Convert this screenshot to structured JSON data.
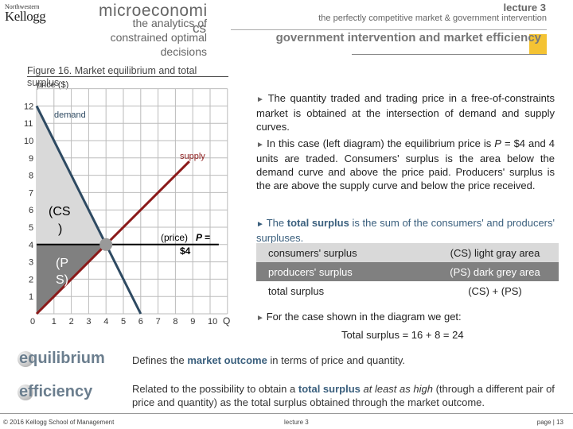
{
  "header": {
    "logo_top": "Northwestern",
    "logo_main": "Kellogg",
    "logo_sub": "Kellogg School of Management",
    "course": "microeconomi",
    "course_cont": "cs",
    "subtitle": "the analytics of constrained optimal decisions",
    "lecture": "lecture 3",
    "lecture_subtitle": "the perfectly competitive market & government intervention",
    "section_title": "government intervention and market efficiency",
    "accent": "#f2b90f"
  },
  "figure": {
    "title": "Figure 16. Market equilibrium and total",
    "title_cont": "surplus",
    "ylabel": "price ($)",
    "xlabel": "Q",
    "demand_label": "demand",
    "supply_label": "supply",
    "cs_label1": "(CS",
    "cs_label2": ")",
    "ps_label1": "(P",
    "ps_label2": "S)",
    "price_label1": "(price)",
    "price_label2": "P =",
    "price_label3": "$4"
  },
  "chart_data": {
    "type": "line",
    "xlabel": "Q",
    "ylabel": "price ($)",
    "xlim": [
      0,
      11
    ],
    "ylim": [
      0,
      13
    ],
    "xticks": [
      0,
      1,
      2,
      3,
      4,
      5,
      6,
      7,
      8,
      9,
      10
    ],
    "yticks": [
      1,
      2,
      3,
      4,
      5,
      6,
      7,
      8,
      9,
      10,
      11,
      12
    ],
    "grid": true,
    "series": [
      {
        "name": "demand",
        "x": [
          0,
          6
        ],
        "y": [
          12,
          0
        ],
        "color": "#2e4a62"
      },
      {
        "name": "supply",
        "x": [
          0,
          8.8
        ],
        "y": [
          0,
          8.8
        ],
        "color": "#8b1a1a"
      }
    ],
    "price_line": 4,
    "equilibrium": {
      "q": 4,
      "p": 4
    },
    "areas": {
      "cs": {
        "points": [
          [
            0,
            12
          ],
          [
            4,
            4
          ],
          [
            0,
            4
          ]
        ],
        "color": "#d9d9d9"
      },
      "ps": {
        "points": [
          [
            0,
            4
          ],
          [
            4,
            4
          ],
          [
            0,
            0
          ]
        ],
        "color": "#808080"
      }
    }
  },
  "text": {
    "p1": "The quantity traded and trading price in a free-of-constraints market is obtained at the intersection of demand and supply curves.",
    "p2a": "In this case (left diagram) the equilibrium price is ",
    "p2b": "P",
    "p2c": " = $4 and 4 units are traded. Consumers' surplus is the area below the demand curve and above the price paid. Producers' surplus is the are above the supply curve and below the price received.",
    "p3a": "The ",
    "p3b": "total surplus",
    "p3c": "  is the sum of the consumers' and producers' surpluses.",
    "table": [
      [
        "consumers' surplus",
        "(CS) light gray area"
      ],
      [
        "producers' surplus",
        "(PS) dark grey area"
      ],
      [
        "total surplus",
        "(CS) + (PS)"
      ]
    ],
    "p4": "For the case shown in the diagram we get:",
    "p5": "Total surplus = 16 + 8 = 24"
  },
  "terms": [
    {
      "term": "equilibrium",
      "a": "Defines the ",
      "b": "market outcome",
      "c": " in terms of price and quantity."
    },
    {
      "term": "efficiency",
      "a": "Related to the possibility to obtain a ",
      "b": "total surplus",
      "c": " ",
      "d": "at least as high",
      "e": " (through a different pair of price and quantity) as the total surplus obtained through the market outcome."
    }
  ],
  "footer": {
    "copyright": "© 2016 Kellogg School of Management",
    "lecture": "lecture 3",
    "page": "page  |  13"
  }
}
